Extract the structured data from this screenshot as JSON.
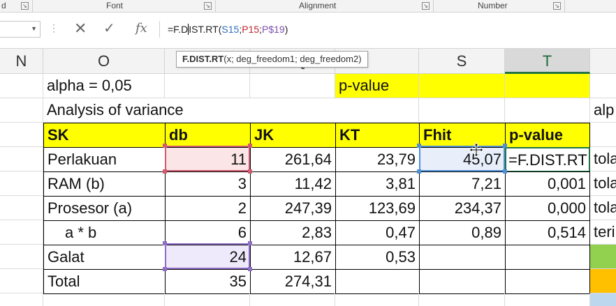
{
  "ribbon": {
    "fragment": "d",
    "font_label": "Font",
    "alignment_label": "Alignment",
    "number_label": "Number"
  },
  "formula_bar": {
    "name_box": "",
    "cancel_icon": "✕",
    "enter_icon": "✓",
    "fx_icon": "fx",
    "formula_prefix": "=F.D",
    "formula_after_caret": "IST.RT(",
    "ref1": "S15",
    "sep1": ";",
    "ref2": "P15",
    "sep2": ";",
    "ref3": "P$19",
    "formula_close": ")"
  },
  "tooltip": {
    "function": "F.DIST.RT",
    "args": "(x; deg_freedom1; deg_freedom2)"
  },
  "columns": {
    "n": "N",
    "o": "O",
    "q_partial": "Q",
    "s": "S",
    "t": "T"
  },
  "rows": {
    "r1": {
      "o": "alpha = 0,05",
      "r": "p-value"
    },
    "r2": {
      "o": "Analysis of variance",
      "u": "alp"
    },
    "header": {
      "sk": "SK",
      "db": "db",
      "jk": "JK",
      "kt": "KT",
      "fhit": "Fhit",
      "pvalue": "p-value"
    },
    "data": [
      {
        "sk": "Perlakuan",
        "db": "11",
        "jk": "261,64",
        "kt": "23,79",
        "fhit": "45,07",
        "pvalue": "=F.DIST.RT",
        "u": "tola"
      },
      {
        "sk": "RAM (b)",
        "db": "3",
        "jk": "11,42",
        "kt": "3,81",
        "fhit": "7,21",
        "pvalue": "0,001",
        "u": "tola"
      },
      {
        "sk": "Prosesor (a)",
        "db": "2",
        "jk": "247,39",
        "kt": "123,69",
        "fhit": "234,37",
        "pvalue": "0,000",
        "u": "tola"
      },
      {
        "sk": "a * b",
        "db": "6",
        "jk": "2,83",
        "kt": "0,47",
        "fhit": "0,89",
        "pvalue": "0,514",
        "u": "teri"
      },
      {
        "sk": "Galat",
        "db": "24",
        "jk": "12,67",
        "kt": "0,53",
        "fhit": "",
        "pvalue": "",
        "u": ""
      },
      {
        "sk": "Total",
        "db": "35",
        "jk": "274,31",
        "kt": "",
        "fhit": "",
        "pvalue": "",
        "u": ""
      }
    ]
  },
  "colors": {
    "yellow": "#ffff00",
    "excel_green": "#217346",
    "ref_pink": "#d05a70",
    "ref_lavender": "#8e6fc6",
    "ref_blue": "#4f8fd6"
  }
}
